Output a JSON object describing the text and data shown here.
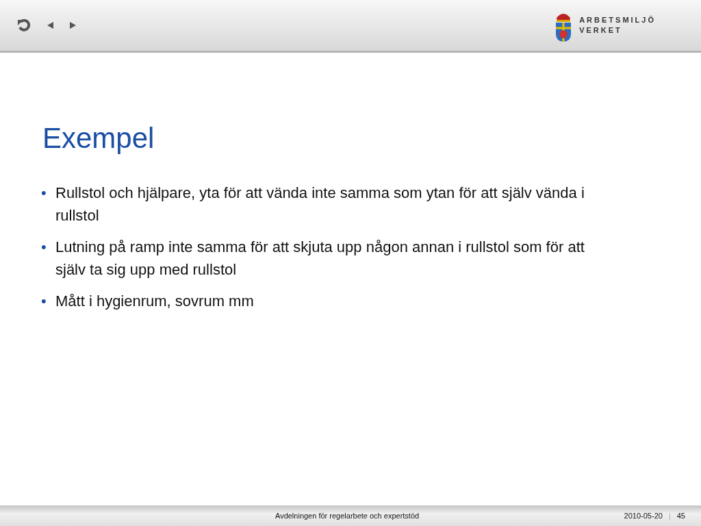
{
  "toolbar": {
    "logo_text": [
      "ARBETSMILJÖ",
      "VERKET"
    ]
  },
  "slide": {
    "title": "Exempel",
    "bullets": [
      {
        "marker": "•",
        "text": "Rullstol och hjälpare, yta för att vända inte samma som ytan för att själv vända i rullstol"
      },
      {
        "marker": "•",
        "text": "Lutning på ramp inte samma för att skjuta upp någon annan i rullstol som för att själv ta sig upp med rullstol"
      },
      {
        "marker": "•",
        "text": "Mått i hygienrum, sovrum mm"
      }
    ]
  },
  "footer": {
    "department": "Avdelningen för regelarbete och expertstöd",
    "date": "2010-05-20",
    "separator": "|",
    "page": "45"
  }
}
